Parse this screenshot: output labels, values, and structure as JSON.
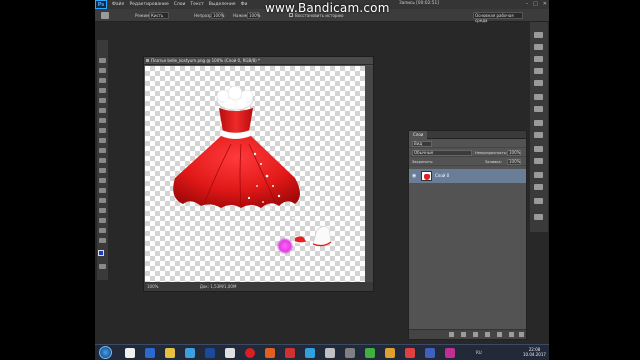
{
  "app": {
    "logo": "Ps"
  },
  "menubar": {
    "items": [
      "Файл",
      "Редактирование",
      "Слои",
      "Текст",
      "Выделение",
      "Фи"
    ],
    "recording": "Запись [00:02:51]"
  },
  "watermark": "www.Bandicam.com",
  "options_bar": {
    "mode_label": "Режим:",
    "mode_value": "Кисть",
    "opacity_label": "Непрозр.:",
    "opacity_value": "100%",
    "flow_label": "Нажим:",
    "flow_value": "100%",
    "restore_label": "Восстановить историю",
    "workspace": "Основная рабочая среда"
  },
  "document": {
    "title": "Платье belle_kostyum.png @ 100% (Слой 0, RGB/8) *",
    "zoom": "100%",
    "doc_size": "Док: 1,53M/1,00M"
  },
  "layers_panel": {
    "tab": "Слои",
    "kind_label": "Вид",
    "blend_mode": "Обычные",
    "opacity_label": "Непрозрачность:",
    "opacity_value": "100%",
    "lock_label": "Закрепить:",
    "fill_label": "Заливка:",
    "fill_value": "100%",
    "layer_name": "Слой 0"
  },
  "taskbar": {
    "lang": "RU",
    "time": "22:08",
    "date": "10.04.2017"
  },
  "colors": {
    "accent": "#6a7d96",
    "dress_red": "#e01818",
    "brush_pink": "#e040e0"
  }
}
